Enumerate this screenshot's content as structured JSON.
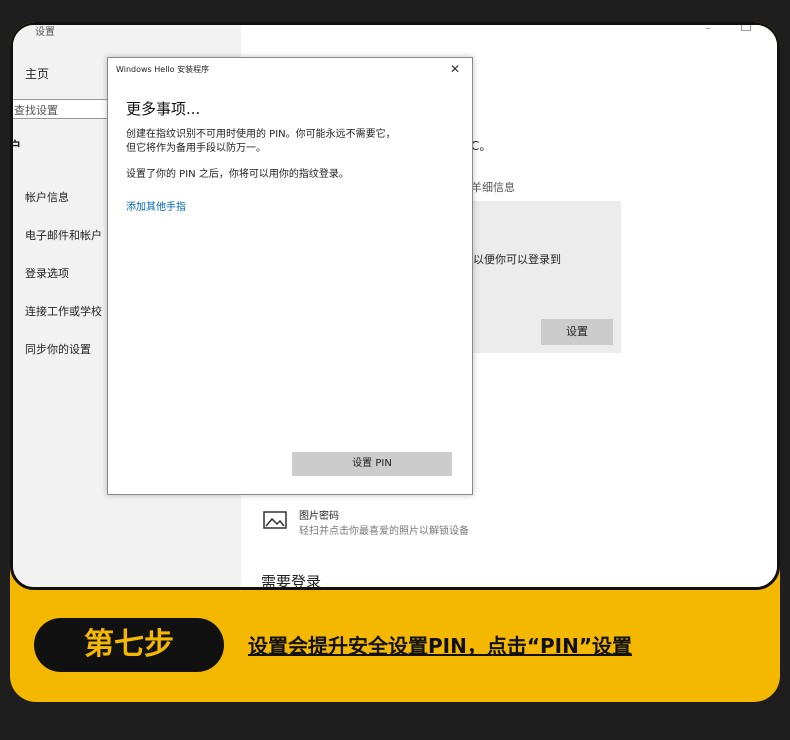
{
  "settings": {
    "app_title": "设置",
    "home": "主页",
    "search_placeholder": "查找设置",
    "section_header": "户",
    "nav_items": [
      {
        "label": "帐户信息"
      },
      {
        "label": "电子邮件和帐户"
      },
      {
        "label": "登录选项"
      },
      {
        "label": "连接工作或学校"
      },
      {
        "label": "同步你的设置"
      }
    ]
  },
  "right": {
    "frag1": "C。",
    "frag2": "羊细信息",
    "frag3": "以便你可以登录到",
    "panel_button": "设置",
    "picture_password_title": "图片密码",
    "picture_password_desc": "轻扫并点击你最喜爱的照片以解锁设备",
    "need_login": "需要登录"
  },
  "dialog": {
    "title": "Windows Hello 安装程序",
    "heading": "更多事项...",
    "paragraph1_line1": "创建在指纹识别不可用时使用的 PIN。你可能永远不需要它，",
    "paragraph1_line2": "但它将作为备用手段以防万一。",
    "paragraph2": "设置了你的 PIN 之后，你将可以用你的指纹登录。",
    "link": "添加其他手指",
    "button": "设置 PIN",
    "close_icon": "close-icon"
  },
  "step": {
    "label": "第七步",
    "instruction": "设置会提升安全设置PIN，点击“PIN”设置"
  },
  "colors": {
    "accent_yellow": "#f5b800",
    "link_blue": "#0067b8",
    "dark": "#1e1e1e"
  }
}
